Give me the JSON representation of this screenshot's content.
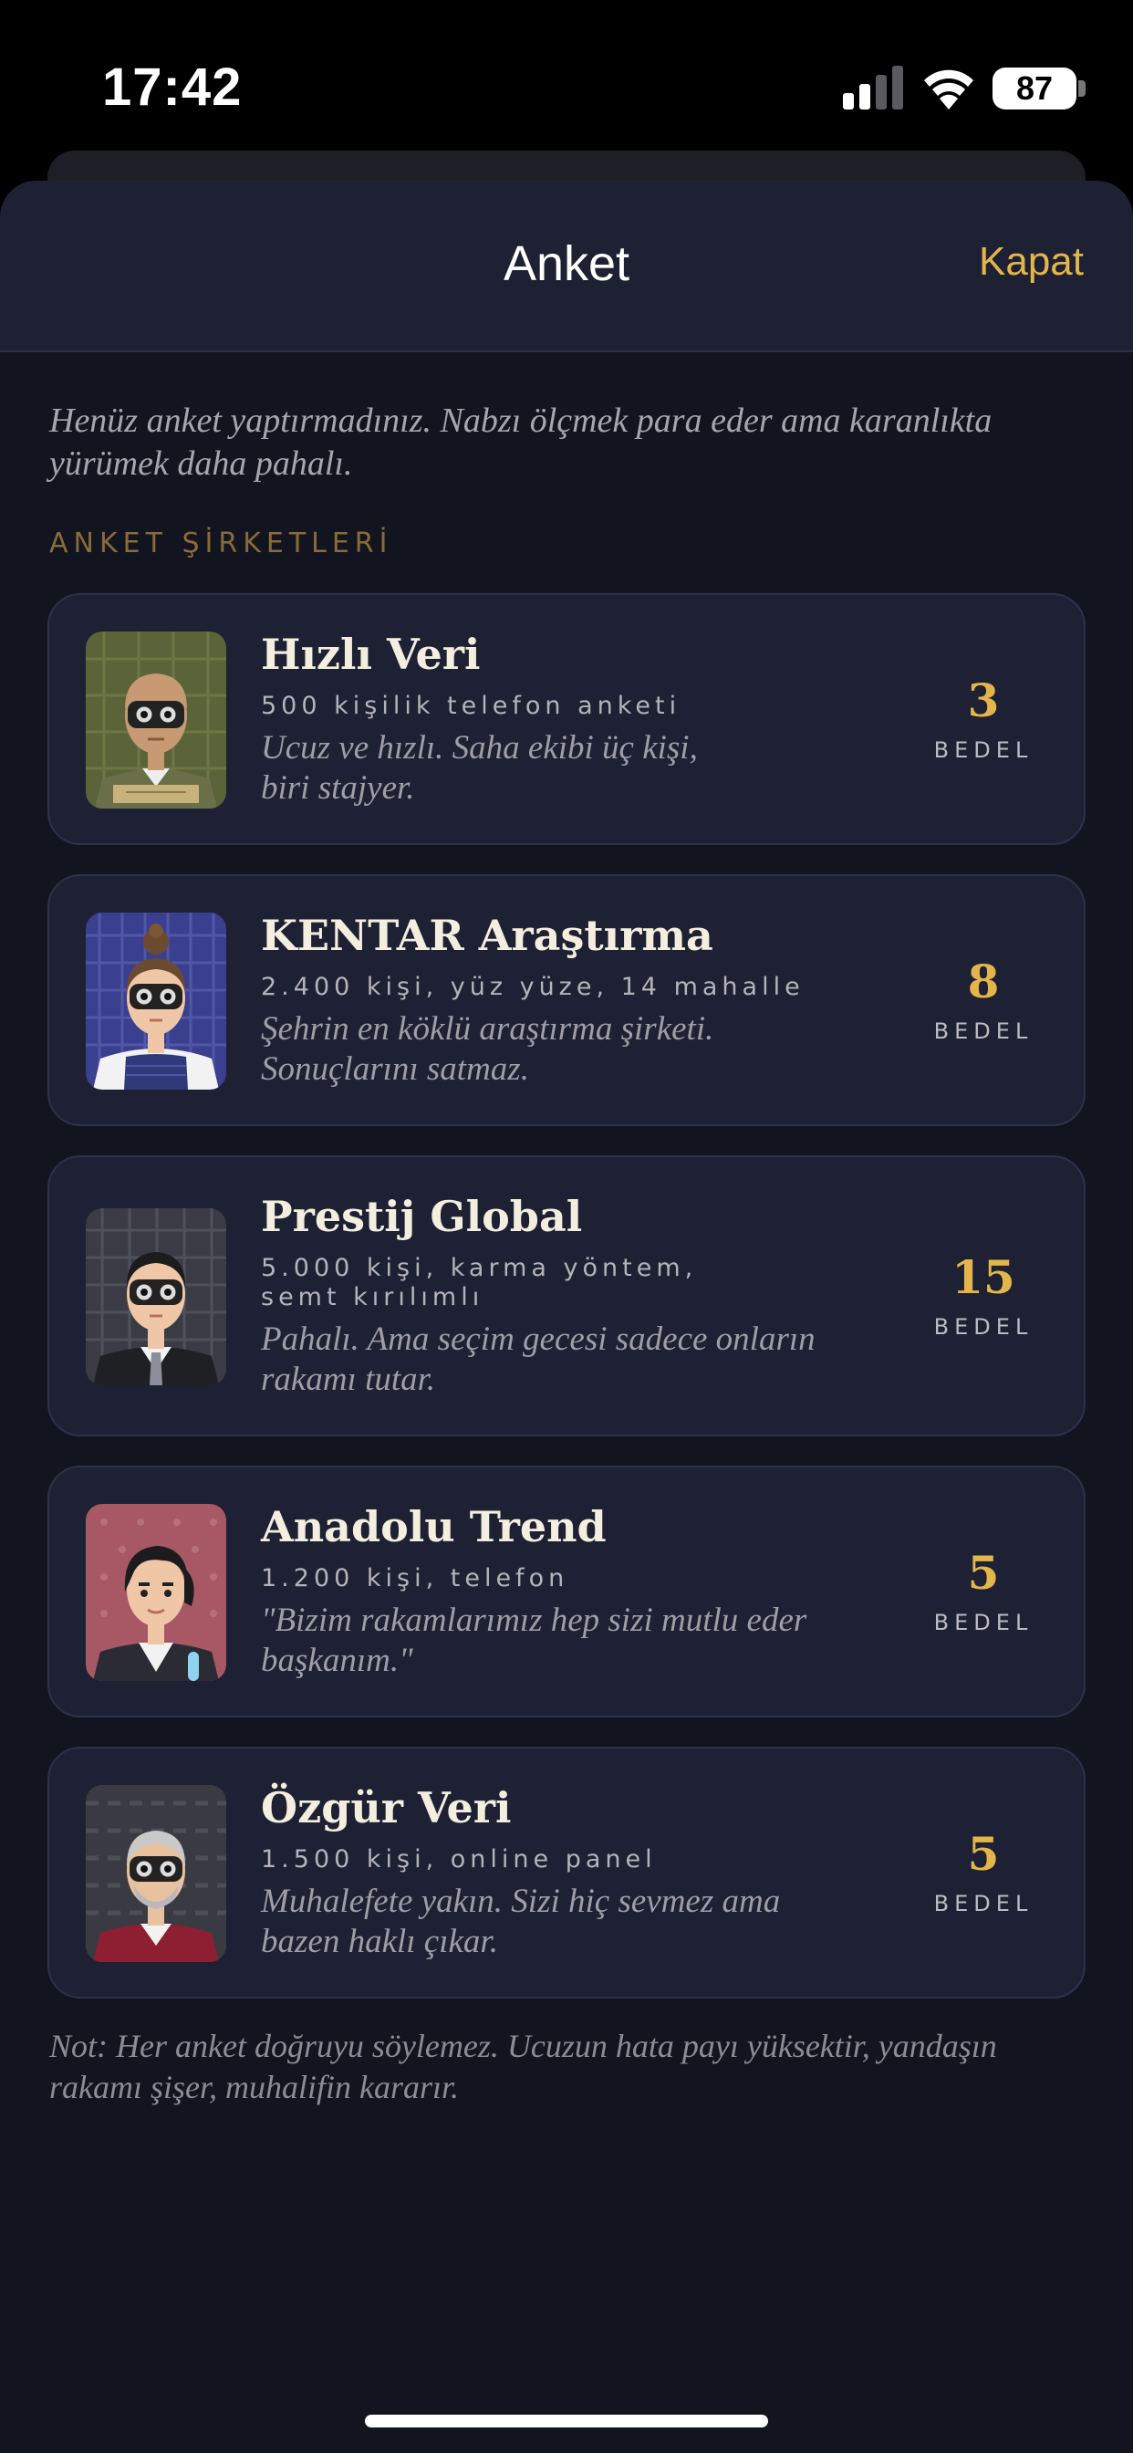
{
  "status_bar": {
    "time": "17:42",
    "battery": "87"
  },
  "header": {
    "title": "Anket",
    "close_label": "Kapat"
  },
  "intro": "Henüz anket yaptırmadınız. Nabzı ölçmek para eder ama karanlıkta yürümek daha pahalı.",
  "section_label": "ANKET ŞİRKETLERİ",
  "cost_label": "BEDEL",
  "companies": [
    {
      "name": "Hızlı Veri",
      "meta": "500 kişilik telefon anketi",
      "desc": "Ucuz ve hızlı. Saha ekibi üç kişi, biri stajyer.",
      "cost": "3"
    },
    {
      "name": "KENTAR Araştırma",
      "meta": "2.400 kişi, yüz yüze, 14 mahalle",
      "desc": "Şehrin en köklü araştırma şirketi. Sonuçlarını satmaz.",
      "cost": "8"
    },
    {
      "name": "Prestij Global",
      "meta": "5.000 kişi, karma yöntem, semt kırılımlı",
      "desc": "Pahalı. Ama seçim gecesi sadece onların rakamı tutar.",
      "cost": "15"
    },
    {
      "name": "Anadolu Trend",
      "meta": "1.200 kişi, telefon",
      "desc": "\"Bizim rakamlarımız hep sizi mutlu eder başkanım.\"",
      "cost": "5"
    },
    {
      "name": "Özgür Veri",
      "meta": "1.500 kişi, online panel",
      "desc": "Muhalefete yakın. Sizi hiç sevmez ama bazen haklı çıkar.",
      "cost": "5"
    }
  ],
  "footnote": "Not: Her anket doğruyu söylemez. Ucuzun hata payı yüksektir, yandaşın rakamı şişer, muhalifin kararır."
}
